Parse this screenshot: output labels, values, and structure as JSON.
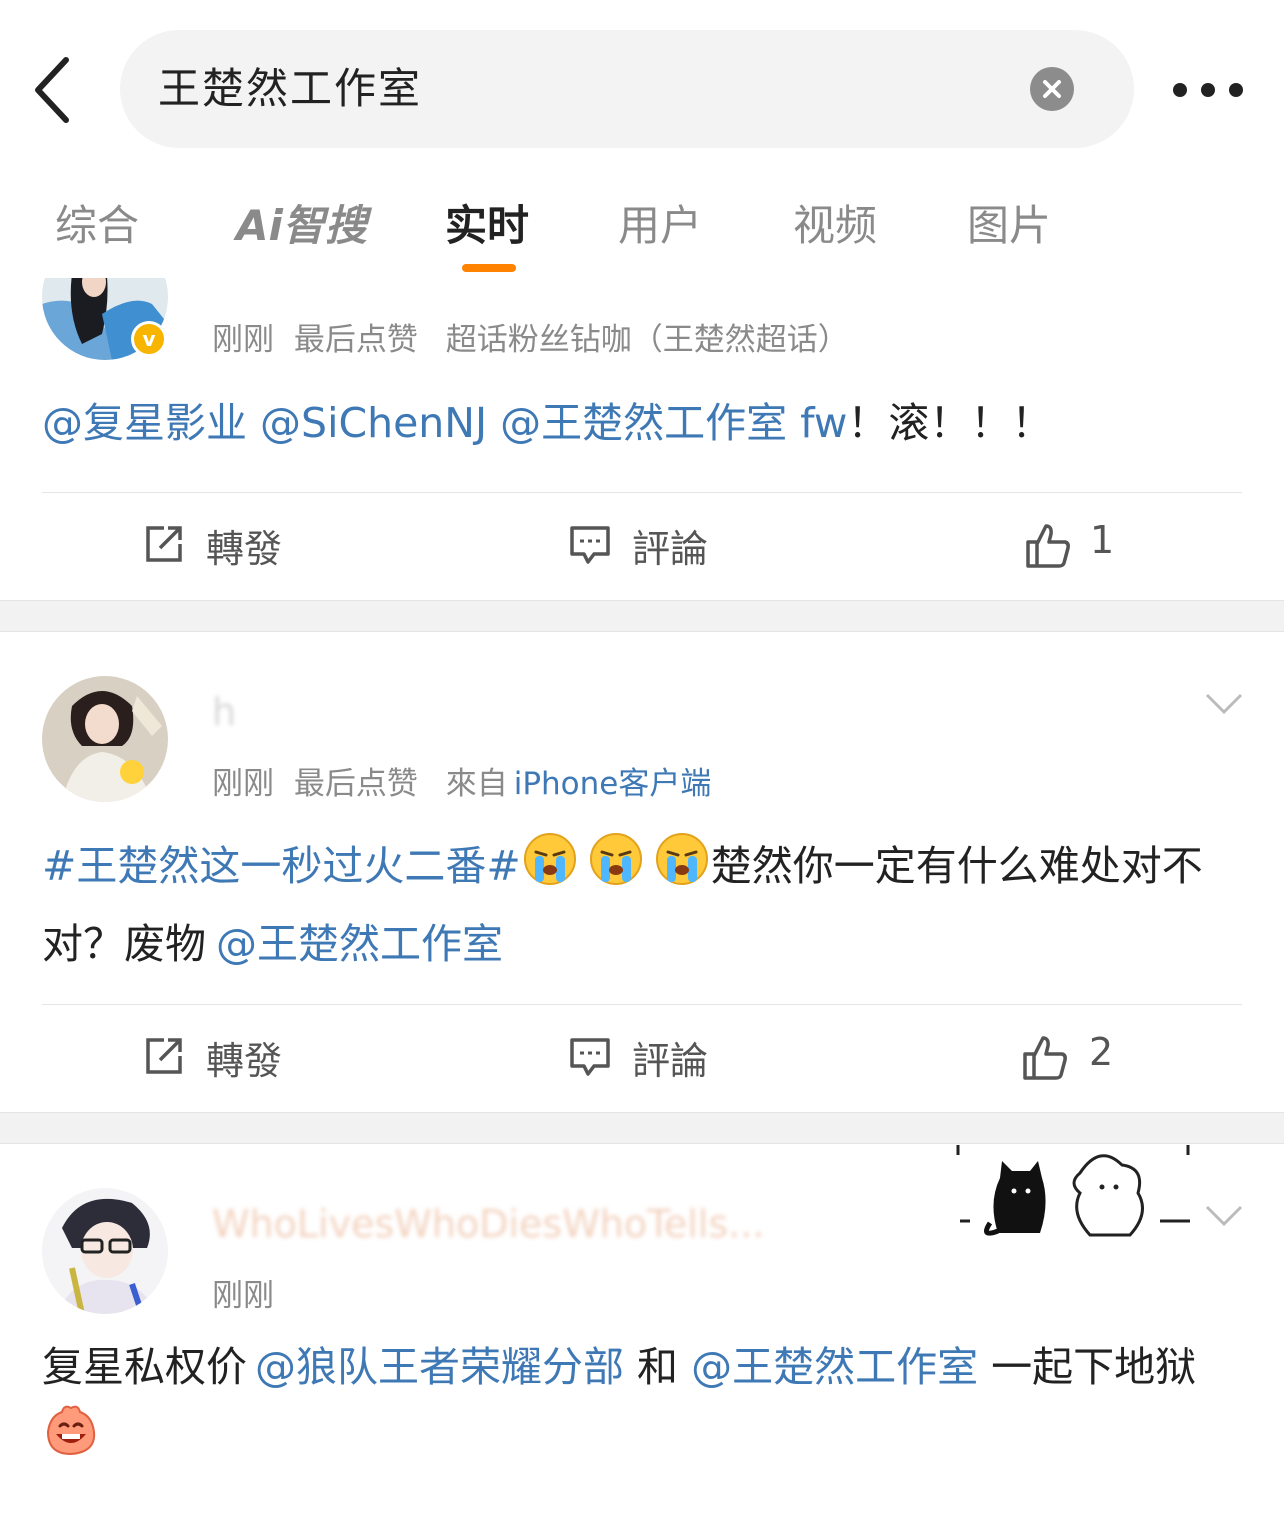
{
  "search": {
    "query": "王楚然工作室"
  },
  "tabs": [
    {
      "label": "综合"
    },
    {
      "label": "Ai智搜"
    },
    {
      "label": "实时"
    },
    {
      "label": "用户"
    },
    {
      "label": "视频"
    },
    {
      "label": "图片"
    }
  ],
  "posts": [
    {
      "time": "刚刚",
      "like_note": "最后点赞",
      "source": "超话粉丝钻咖（王楚然超话）",
      "text_parts": [
        "@复星影业",
        " ",
        "@SiChenNJ",
        " ",
        "@王楚然工作室",
        " fw",
        "！滚！！！"
      ],
      "repost_label": "轉發",
      "comment_label": "評論",
      "like_count": "1"
    },
    {
      "username": "h",
      "time": "刚刚",
      "like_note": "最后点赞",
      "source_prefix": "來自",
      "source": "iPhone客户端",
      "hashtag": "#王楚然这一秒过火二番#",
      "text_after_emoji": "楚然你一定有什么难处对不对？废物",
      "mention": "@王楚然工作室",
      "repost_label": "轉發",
      "comment_label": "評論",
      "like_count": "2"
    },
    {
      "username": "WhoLivesWhoDiesWhoTells...",
      "time": "刚刚",
      "text_a": "复星私权价",
      "mention1": "@狼队王者荣耀分部",
      "text_b": " 和 ",
      "mention2": "@王楚然工作室",
      "text_c": " 一起下地狱"
    }
  ],
  "colors": {
    "accent": "#ff8200",
    "link": "#3f79b5",
    "badge": "#f7b500",
    "gap": "#f2f2f2"
  },
  "icons": [
    "back-arrow-icon",
    "clear-icon",
    "more-icon",
    "add-tab-icon",
    "verified-badge-icon",
    "repost-icon",
    "comment-icon",
    "like-icon",
    "chevron-down-icon",
    "crying-emoji-icon",
    "laughing-emoji-icon"
  ]
}
